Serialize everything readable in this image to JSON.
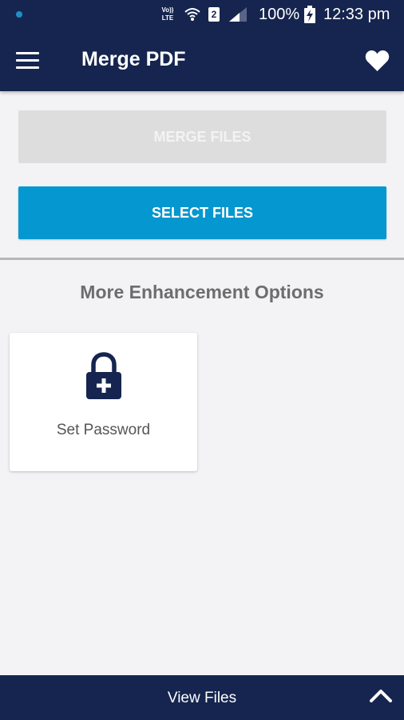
{
  "status_bar": {
    "volte_label": "Vo)) LTE",
    "sim_slot": "2",
    "battery_percent": "100%",
    "time": "12:33 pm",
    "icons": [
      "notification-dot-icon",
      "volte-icon",
      "wifi-icon",
      "sim-icon",
      "signal-icon",
      "battery-charging-icon"
    ]
  },
  "app_bar": {
    "title": "Merge PDF",
    "menu_icon": "hamburger-menu-icon",
    "favorite_icon": "heart-icon"
  },
  "actions": {
    "merge_label": "MERGE FILES",
    "merge_enabled": false,
    "select_label": "SELECT FILES"
  },
  "enhancements": {
    "title": "More Enhancement Options",
    "options": [
      {
        "label": "Set Password",
        "icon": "lock-plus-icon"
      }
    ]
  },
  "bottom_bar": {
    "label": "View Files",
    "icon": "chevron-up-icon"
  },
  "colors": {
    "primary_dark": "#16254f",
    "accent": "#0497d0",
    "disabled": "#dddddd",
    "background": "#f3f3f5"
  }
}
